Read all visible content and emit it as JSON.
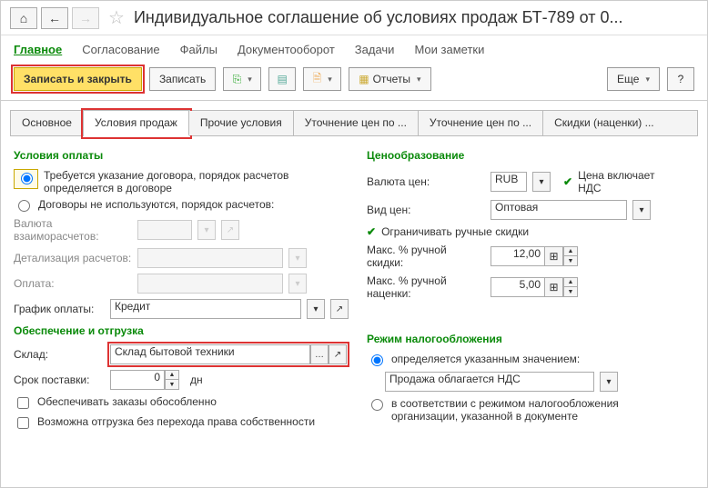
{
  "window": {
    "title": "Индивидуальное соглашение об условиях продаж БТ-789 от 0..."
  },
  "menubar": {
    "main": "Главное",
    "approval": "Согласование",
    "files": "Файлы",
    "docflow": "Документооборот",
    "tasks": "Задачи",
    "notes": "Мои заметки"
  },
  "toolbar": {
    "save_close": "Записать и закрыть",
    "save": "Записать",
    "reports": "Отчеты",
    "more": "Еще",
    "help": "?"
  },
  "tabs": {
    "t0": "Основное",
    "t1": "Условия продаж",
    "t2": "Прочие условия",
    "t3": "Уточнение цен по ...",
    "t4": "Уточнение цен по ...",
    "t5": "Скидки (наценки) ..."
  },
  "pay": {
    "title": "Условия оплаты",
    "r1": "Требуется указание договора, порядок расчетов определяется в договоре",
    "r2": "Договоры не используются, порядок расчетов:",
    "currency_lbl": "Валюта взаиморасчетов:",
    "detail_lbl": "Детализация расчетов:",
    "pay_lbl": "Оплата:",
    "schedule_lbl": "График оплаты:",
    "schedule_val": "Кредит"
  },
  "ship": {
    "title": "Обеспечение и отгрузка",
    "warehouse_lbl": "Склад:",
    "warehouse_val": "Склад бытовой техники",
    "delivery_lbl": "Срок поставки:",
    "delivery_val": "0",
    "delivery_unit": "дн",
    "c1": "Обеспечивать заказы обособленно",
    "c2": "Возможна отгрузка без перехода права собственности"
  },
  "price": {
    "title": "Ценообразование",
    "cur_lbl": "Валюта цен:",
    "cur_val": "RUB",
    "vat": "Цена включает НДС",
    "type_lbl": "Вид цен:",
    "type_val": "Оптовая",
    "limit": "Ограничивать ручные скидки",
    "maxd_lbl": "Макс. % ручной скидки:",
    "maxd_val": "12,00",
    "maxm_lbl": "Макс. % ручной наценки:",
    "maxm_val": "5,00"
  },
  "tax": {
    "title": "Режим налогообложения",
    "r1": "определяется указанным значением:",
    "sel": "Продажа облагается НДС",
    "r2": "в соответствии с режимом налогообложения организации, указанной в документе"
  }
}
